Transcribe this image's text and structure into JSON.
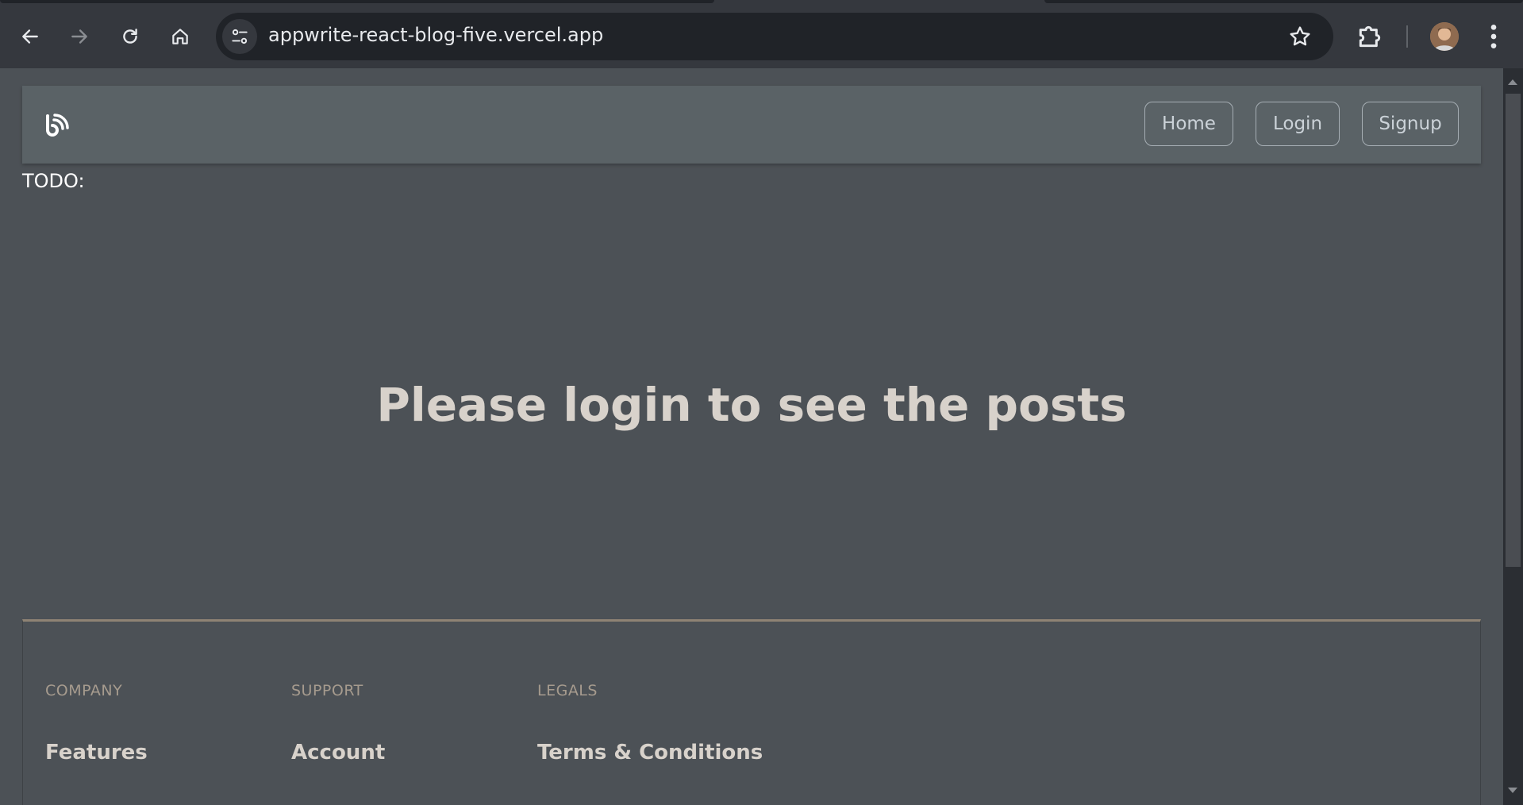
{
  "browser": {
    "url": "appwrite-react-blog-five.vercel.app",
    "icons": {
      "back": "arrow-left-icon",
      "forward": "arrow-right-icon",
      "reload": "reload-icon",
      "home": "home-icon",
      "site_info": "tune-icon",
      "bookmark": "star-icon",
      "extensions": "puzzle-icon",
      "menu": "kebab-menu-icon"
    }
  },
  "header": {
    "logo_icon": "blog-logo-icon",
    "nav": [
      {
        "label": "Home"
      },
      {
        "label": "Login"
      },
      {
        "label": "Signup"
      }
    ]
  },
  "main": {
    "todo_text": "TODO:",
    "message": "Please login to see the posts"
  },
  "footer": {
    "columns": [
      {
        "heading": "COMPANY",
        "link": "Features"
      },
      {
        "heading": "SUPPORT",
        "link": "Account"
      },
      {
        "heading": "LEGALS",
        "link": "Terms & Conditions"
      }
    ]
  },
  "colors": {
    "page_background": "#4c5156",
    "header_background": "#5a6266",
    "headline_text": "#d8d2cb",
    "footer_border": "#8f8374",
    "footer_heading": "#a69b8e"
  }
}
